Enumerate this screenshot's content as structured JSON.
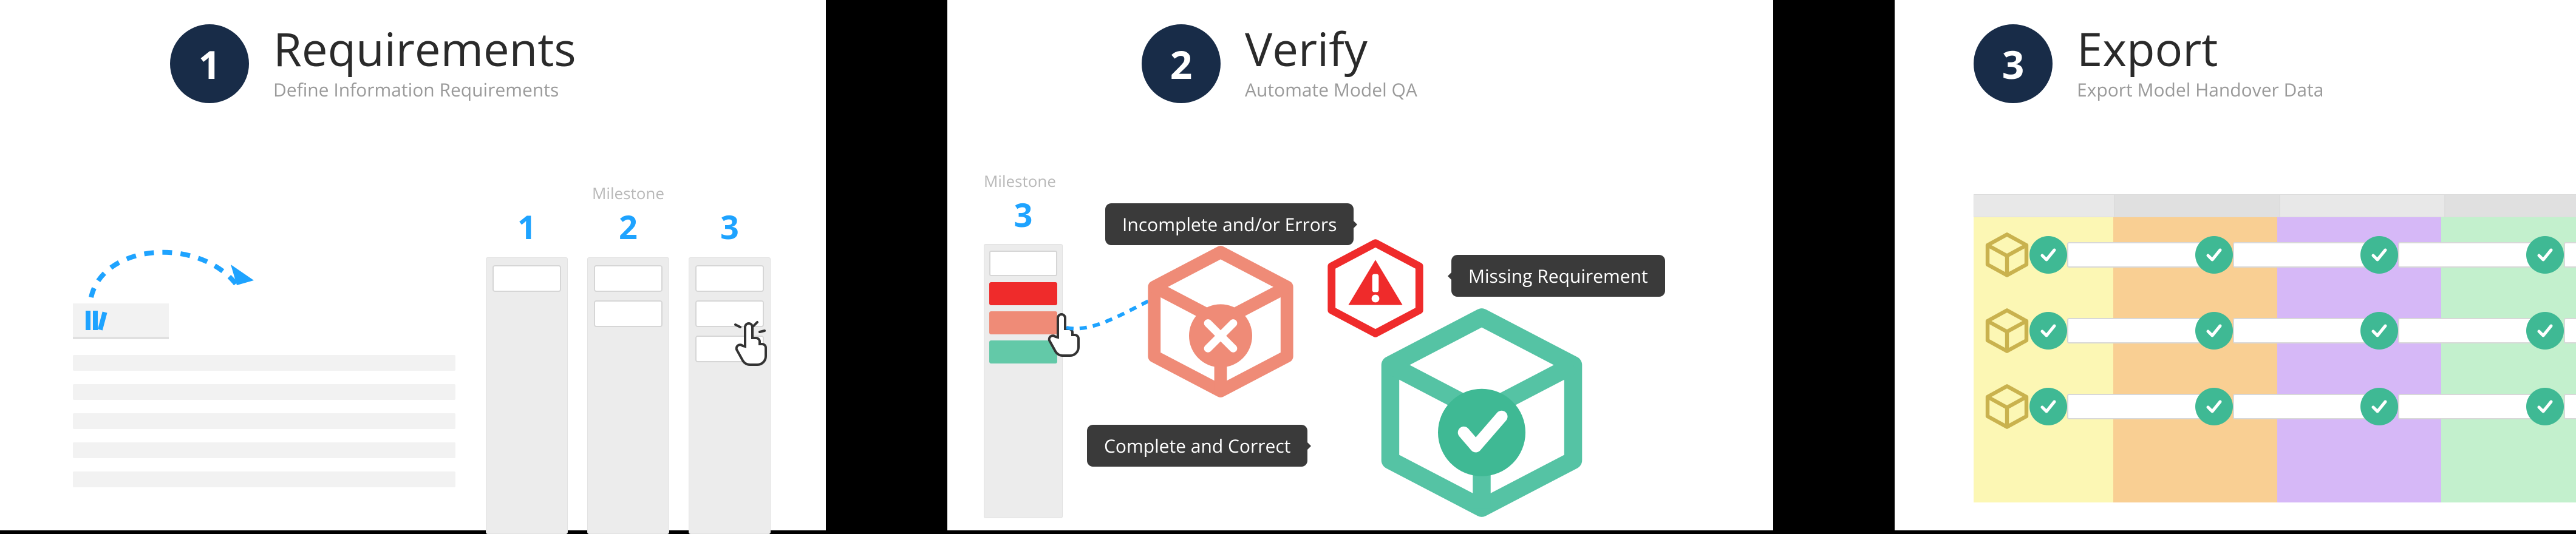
{
  "steps": [
    {
      "num": "1",
      "title": "Requirements",
      "subtitle": "Define Information Requirements",
      "milestone_label": "Milestone",
      "cols": [
        {
          "num": "1",
          "slots": 1
        },
        {
          "num": "2",
          "slots": 2
        },
        {
          "num": "3",
          "slots": 3
        }
      ]
    },
    {
      "num": "2",
      "title": "Verify",
      "subtitle": "Automate Model QA",
      "milestone_label": "Milestone",
      "col": {
        "num": "3",
        "slots": [
          "empty",
          "red",
          "salmon",
          "teal"
        ]
      },
      "badges": {
        "incomplete": "Incomplete and/or Errors",
        "missing": "Missing Requirement",
        "complete": "Complete and Correct"
      }
    },
    {
      "num": "3",
      "title": "Export",
      "subtitle": "Export Model Handover Data",
      "columns": [
        "y",
        "o",
        "p",
        "g"
      ],
      "rows": 3,
      "checks_per_row": 4
    }
  ],
  "colors": {
    "navy": "#182c48",
    "blue": "#1ea3ff",
    "teal": "#3fb994",
    "salmon": "#ef8b77",
    "red": "#ef2b2b"
  }
}
